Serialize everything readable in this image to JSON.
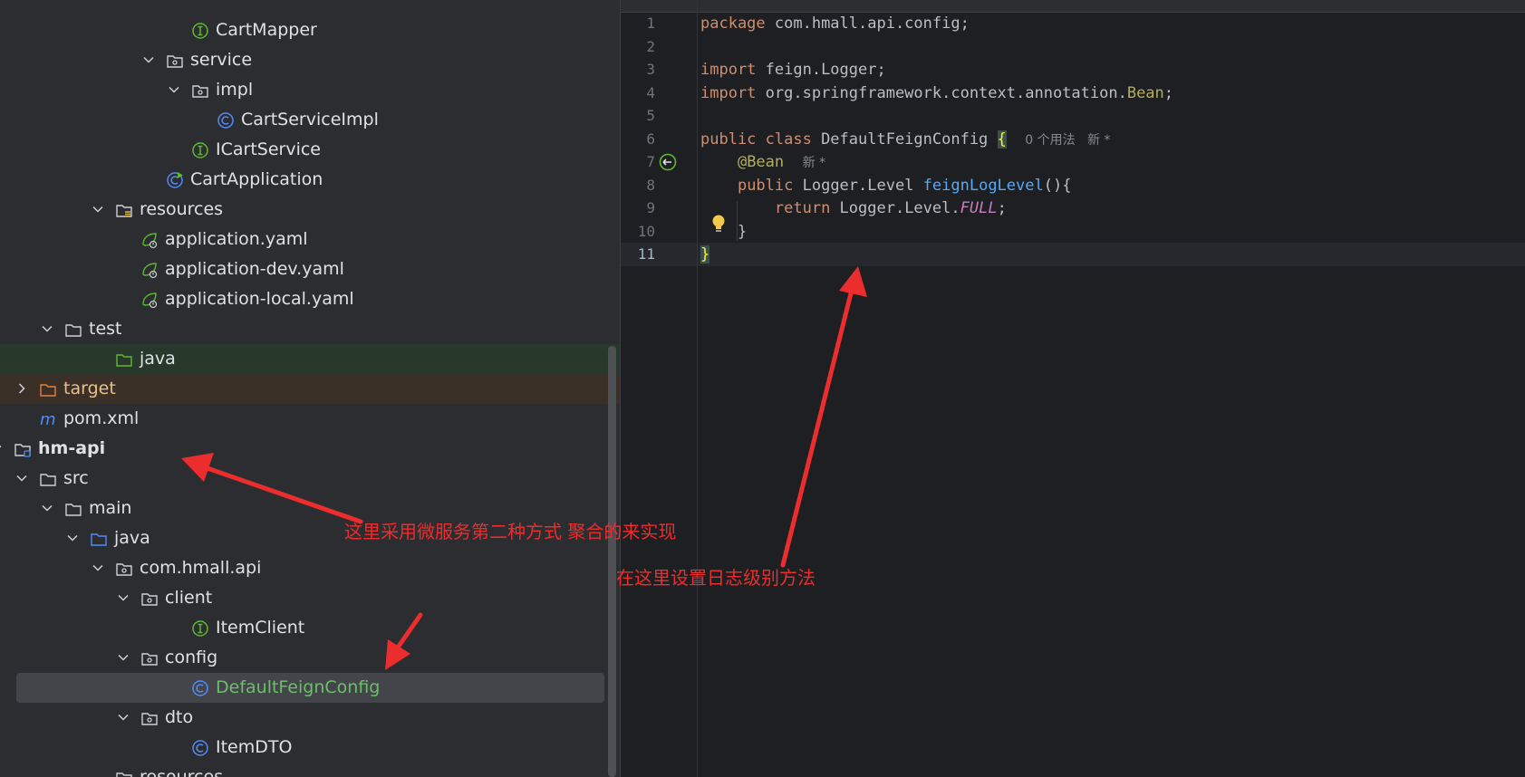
{
  "project_tree": {
    "rows": [
      {
        "label": "CartMapper",
        "icon": "interface-icon",
        "expanded": null
      },
      {
        "label": "service",
        "icon": "package-icon",
        "expanded": true
      },
      {
        "label": "impl",
        "icon": "package-icon",
        "expanded": true
      },
      {
        "label": "CartServiceImpl",
        "icon": "class-icon",
        "expanded": null
      },
      {
        "label": "ICartService",
        "icon": "interface-icon",
        "expanded": null
      },
      {
        "label": "CartApplication",
        "icon": "spring-boot-class-icon",
        "expanded": null
      },
      {
        "label": "resources",
        "icon": "resources-folder-icon",
        "expanded": true
      },
      {
        "label": "application.yaml",
        "icon": "spring-yaml-icon",
        "expanded": null
      },
      {
        "label": "application-dev.yaml",
        "icon": "spring-yaml-icon",
        "expanded": null
      },
      {
        "label": "application-local.yaml",
        "icon": "spring-yaml-icon",
        "expanded": null
      },
      {
        "label": "test",
        "icon": "folder-icon",
        "expanded": true
      },
      {
        "label": "java",
        "icon": "test-source-folder-icon",
        "expanded": null
      },
      {
        "label": "target",
        "icon": "excluded-folder-icon",
        "expanded": false
      },
      {
        "label": "pom.xml",
        "icon": "maven-icon",
        "expanded": null
      },
      {
        "label": "hm-api",
        "icon": "module-folder-icon",
        "expanded": true
      },
      {
        "label": "src",
        "icon": "folder-icon",
        "expanded": true
      },
      {
        "label": "main",
        "icon": "folder-icon",
        "expanded": true
      },
      {
        "label": "java",
        "icon": "source-folder-icon",
        "expanded": true
      },
      {
        "label": "com.hmall.api",
        "icon": "package-icon",
        "expanded": true
      },
      {
        "label": "client",
        "icon": "package-icon",
        "expanded": true
      },
      {
        "label": "ItemClient",
        "icon": "interface-icon",
        "expanded": null
      },
      {
        "label": "config",
        "icon": "package-icon",
        "expanded": true
      },
      {
        "label": "DefaultFeignConfig",
        "icon": "class-icon",
        "expanded": null
      },
      {
        "label": "dto",
        "icon": "package-icon",
        "expanded": true
      },
      {
        "label": "ItemDTO",
        "icon": "class-icon",
        "expanded": null
      },
      {
        "label": "resources",
        "icon": "folder-icon",
        "expanded": null
      }
    ],
    "selected": "DefaultFeignConfig"
  },
  "editor": {
    "line_numbers": [
      "1",
      "2",
      "3",
      "4",
      "5",
      "6",
      "7",
      "8",
      "9",
      "10",
      "11"
    ],
    "current_line": "11",
    "code": {
      "l1_kw": "package",
      "l1_rest": " com.hmall.api.config;",
      "l3_kw": "import",
      "l3_rest": " feign.Logger;",
      "l4_kw": "import",
      "l4_rest": " org.springframework.context.annotation.",
      "l4_ann": "Bean",
      "l4_semi": ";",
      "l6_kw": "public class",
      "l6_rest": " DefaultFeignConfig ",
      "l6_brace": "{",
      "l6_hint": "0 个用法   新 *",
      "l7_indent": "    ",
      "l7_ann": "@Bean",
      "l7_hint": "新 *",
      "l8_indent": "    ",
      "l8_kw": "public",
      "l8_type": " Logger.Level ",
      "l8_fn": "feignLogLevel",
      "l8_rest": "(){",
      "l9_indent": "        ",
      "l9_kw": "return",
      "l9_rest": " Logger.Level.",
      "l9_const": "FULL",
      "l9_semi": ";",
      "l10": "    }",
      "l11_brace": "}"
    }
  },
  "annotations": {
    "note_aggregation": "这里采用微服务第二种方式 聚合的来实现",
    "note_log_level": "在这里设置日志级别方法",
    "arrow_color": "#ec2d2d"
  }
}
